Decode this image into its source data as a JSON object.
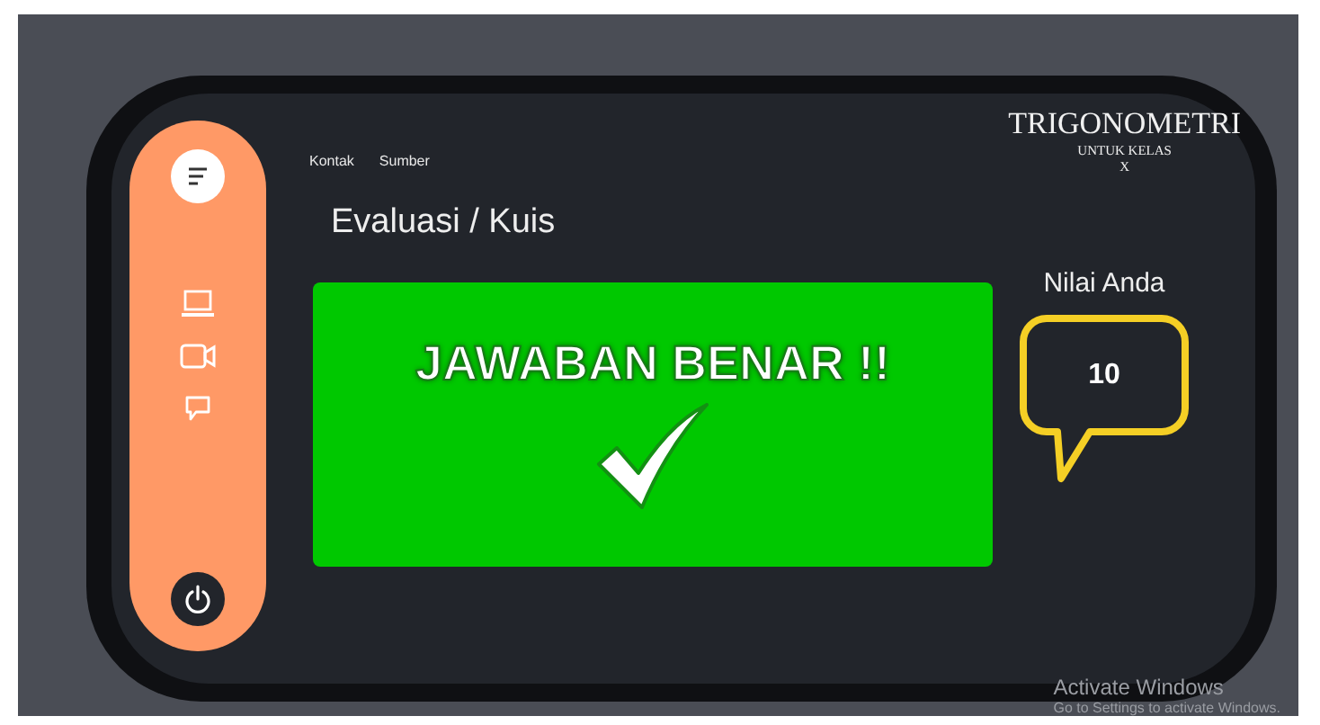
{
  "nav_links": [
    "Kontak",
    "Sumber"
  ],
  "brand": {
    "title": "TRIGONOMETRI",
    "subtitle": "UNTUK KELAS",
    "grade": "X"
  },
  "heading": "Evaluasi / Kuis",
  "result": {
    "message": "JAWABAN BENAR !!",
    "correct": true
  },
  "score": {
    "label": "Nilai Anda",
    "value": "10"
  },
  "watermark": {
    "title": "Activate Windows",
    "hint": "Go to Settings to activate Windows."
  }
}
